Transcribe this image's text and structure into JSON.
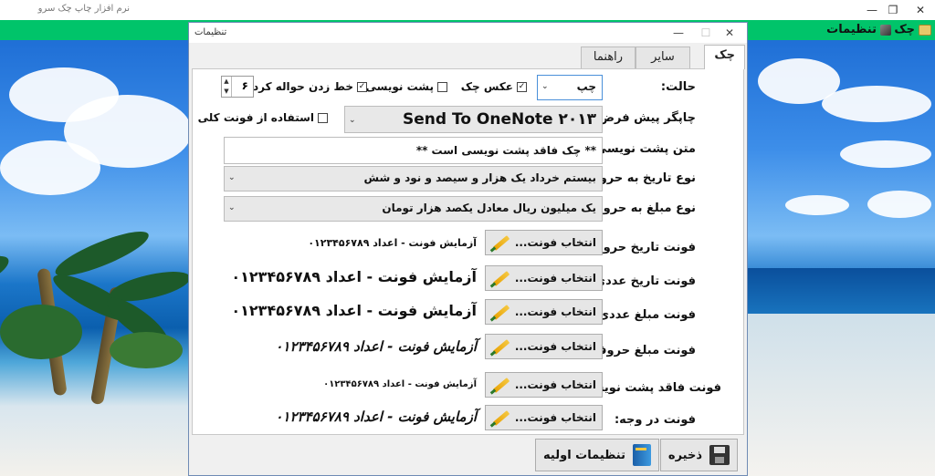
{
  "app": {
    "title": "نرم افزار چاپ چک سرو",
    "menu": [
      {
        "label": "چک"
      },
      {
        "label": "تنظیمات"
      }
    ]
  },
  "dialog": {
    "title": "تنظیمات",
    "tabs": [
      {
        "label": "چک",
        "active": true
      },
      {
        "label": "سایر",
        "active": false
      },
      {
        "label": "راهنما",
        "active": false
      }
    ],
    "state": {
      "label": "حالت:",
      "value": "چپ",
      "options_check_photo": {
        "label": "عکس چک",
        "checked": true
      },
      "options_back_print": {
        "label": "پشت نویسی",
        "checked": false
      },
      "options_transfer_line": {
        "label": "خط زدن حواله کرد:",
        "checked": true
      },
      "transfer_count": "۶"
    },
    "printer": {
      "label": "چاپگر پیش فرض:",
      "value": "Send To OneNote ۲۰۱۳",
      "use_global_font": {
        "label": "استفاده از فونت کلی",
        "checked": false
      }
    },
    "back_text": {
      "label": "متن پشت نویسی:",
      "value": "** چک فاقد پشت نویسی است **"
    },
    "date_words": {
      "label": "نوع تاریخ به حروف:",
      "value": "بیستم خرداد یک هزار و سیصد و نود و شش"
    },
    "amount_words": {
      "label": "نوع مبلغ به حروف:",
      "value": "یک میلیون ریال معادل یکصد هزار تومان"
    },
    "font_button_label": "انتخاب فونت...",
    "font_rows": [
      {
        "label": "فونت تاریخ حروفی:",
        "sample": "آزمایش فونت - اعداد ۰۱۲۳۴۵۶۷۸۹"
      },
      {
        "label": "فونت تاریخ عددی:",
        "sample": "آزمایش فونت - اعداد ۰۱۲۳۴۵۶۷۸۹"
      },
      {
        "label": "فونت مبلغ عددی:",
        "sample": "آزمایش فونت - اعداد ۰۱۲۳۴۵۶۷۸۹"
      },
      {
        "label": "فونت مبلغ حروفی:",
        "sample": "آزمایش فونت - اعداد ۰۱۲۳۴۵۶۷۸۹"
      },
      {
        "label": "فونت فاقد پشت نویسی:",
        "sample": "آزمایش فونت - اعداد ۰۱۲۳۴۵۶۷۸۹"
      },
      {
        "label": "فونت در وجه:",
        "sample": "آزمایش فونت - اعداد ۰۱۲۳۴۵۶۷۸۹"
      }
    ],
    "footer": {
      "save_label": "ذخیره",
      "defaults_label": "تنظیمات اولیه"
    }
  },
  "colors": {
    "menubar": "#00c46a",
    "dialog_border": "#6f8bb5"
  }
}
